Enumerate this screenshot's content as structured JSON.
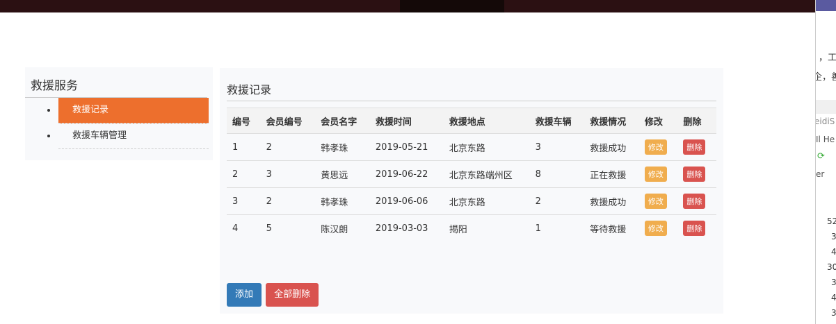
{
  "sidebar": {
    "title": "救援服务",
    "items": [
      {
        "label": "救援记录"
      },
      {
        "label": "救援车辆管理"
      }
    ]
  },
  "main": {
    "title": "救援记录",
    "columns": [
      "编号",
      "会员编号",
      "会员名字",
      "救援时间",
      "救援地点",
      "救援车辆",
      "救援情况",
      "修改",
      "删除"
    ],
    "rows": [
      [
        "1",
        "2",
        "韩孝珠",
        "2019-05-21",
        "北京东路",
        "3",
        "救援成功"
      ],
      [
        "2",
        "3",
        "黄思远",
        "2019-06-22",
        "北京东路端州区",
        "8",
        "正在救援"
      ],
      [
        "3",
        "2",
        "韩孝珠",
        "2019-06-06",
        "北京东路",
        "2",
        "救援成功"
      ],
      [
        "4",
        "5",
        "陈汉朗",
        "2019-03-03",
        "揭阳",
        "1",
        "等待救援"
      ]
    ],
    "edit_label": "修改",
    "delete_label": "删除",
    "add_label": "添加",
    "delete_all_label": "全部删除"
  },
  "background_window": {
    "lines": [
      "，工",
      "企，善",
      "eidiS",
      "Il He",
      "er",
      "52",
      "3",
      "4",
      "30",
      "3",
      "4",
      "3"
    ]
  }
}
